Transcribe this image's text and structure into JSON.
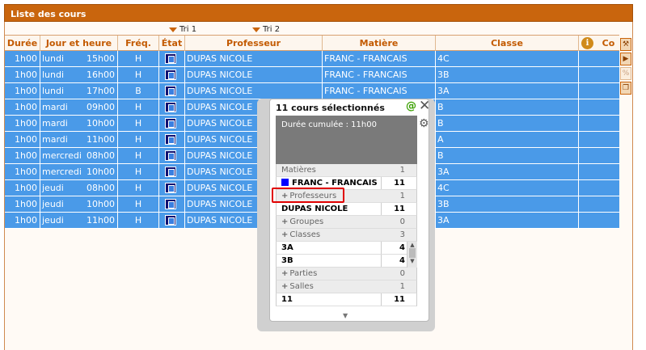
{
  "window": {
    "title": "Liste des cours"
  },
  "sort": {
    "tri1": "Tri 1",
    "tri2": "Tri 2"
  },
  "columns": [
    "Durée",
    "Jour et heure",
    "Fréq.",
    "État",
    "Professeur",
    "Matière",
    "Classe",
    "Co"
  ],
  "rows": [
    {
      "duree": "1h00",
      "jour": "lundi",
      "heure": "15h00",
      "freq": "H",
      "prof": "DUPAS NICOLE",
      "matiere": "FRANC - FRANCAIS",
      "classe": "4C"
    },
    {
      "duree": "1h00",
      "jour": "lundi",
      "heure": "16h00",
      "freq": "H",
      "prof": "DUPAS NICOLE",
      "matiere": "FRANC - FRANCAIS",
      "classe": "3B"
    },
    {
      "duree": "1h00",
      "jour": "lundi",
      "heure": "17h00",
      "freq": "B",
      "prof": "DUPAS NICOLE",
      "matiere": "FRANC - FRANCAIS",
      "classe": "3A"
    },
    {
      "duree": "1h00",
      "jour": "mardi",
      "heure": "09h00",
      "freq": "H",
      "prof": "DUPAS NICOLE",
      "matiere": "",
      "classe": "B"
    },
    {
      "duree": "1h00",
      "jour": "mardi",
      "heure": "10h00",
      "freq": "H",
      "prof": "DUPAS NICOLE",
      "matiere": "",
      "classe": "B"
    },
    {
      "duree": "1h00",
      "jour": "mardi",
      "heure": "11h00",
      "freq": "H",
      "prof": "DUPAS NICOLE",
      "matiere": "",
      "classe": "A"
    },
    {
      "duree": "1h00",
      "jour": "mercredi",
      "heure": "08h00",
      "freq": "H",
      "prof": "DUPAS NICOLE",
      "matiere": "",
      "classe": "B"
    },
    {
      "duree": "1h00",
      "jour": "mercredi",
      "heure": "10h00",
      "freq": "H",
      "prof": "DUPAS NICOLE",
      "matiere": "",
      "classe": "3A"
    },
    {
      "duree": "1h00",
      "jour": "jeudi",
      "heure": "08h00",
      "freq": "H",
      "prof": "DUPAS NICOLE",
      "matiere": "",
      "classe": "4C"
    },
    {
      "duree": "1h00",
      "jour": "jeudi",
      "heure": "10h00",
      "freq": "H",
      "prof": "DUPAS NICOLE",
      "matiere": "",
      "classe": "3B"
    },
    {
      "duree": "1h00",
      "jour": "jeudi",
      "heure": "11h00",
      "freq": "H",
      "prof": "DUPAS NICOLE",
      "matiere": "",
      "classe": "3A"
    }
  ],
  "popup": {
    "title": "11 cours sélectionnés",
    "at": "@",
    "summary": "Durée cumulée :  11h00",
    "matieres_label": "Matières",
    "matieres_count": "1",
    "matiere_value": "FRANC - FRANCAIS",
    "matiere_value_count": "11",
    "professeurs_label": "Professeurs",
    "professeurs_count": "1",
    "professeur_value": "DUPAS NICOLE",
    "professeur_value_count": "11",
    "groupes_label": "Groupes",
    "groupes_count": "0",
    "classes_label": "Classes",
    "classes_count": "3",
    "classe1": "3A",
    "classe1_count": "4",
    "classe2": "3B",
    "classe2_count": "4",
    "parties_label": "Parties",
    "parties_count": "0",
    "salles_label": "Salles",
    "salles_count": "1",
    "salle_value": "11",
    "salle_value_count": "11"
  },
  "colors": {
    "accent": "#c9650d",
    "selected_row": "#4a9ae8"
  }
}
